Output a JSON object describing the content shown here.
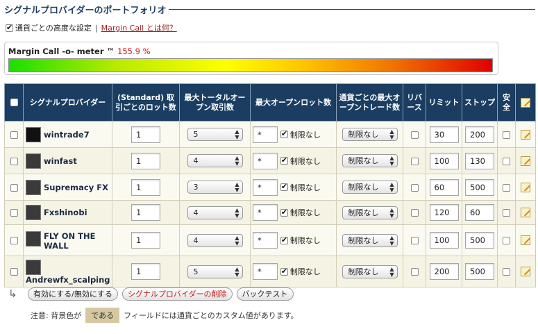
{
  "header": {
    "title": "シグナルプロバイダーのポートフォリオ"
  },
  "advanced": {
    "checkbox_label": "通貨ごとの高度な設定",
    "separator": "|",
    "link_text": "Margin Call とは何？",
    "checked": true
  },
  "meter": {
    "label": "Margin Call -o- meter ™",
    "value": "155.9 %",
    "value_color": "#e01010"
  },
  "table": {
    "columns": [
      "シグナルプロバイダー",
      "(Standard) 取引ごとのロット数",
      "最大トータルオープン取引数",
      "最大オープンロット数",
      "通貨ごとの最大オープントレード数",
      "リバース",
      "リミット",
      "ストップ",
      "安全"
    ],
    "rows": [
      {
        "provider": "wintrade7",
        "lots": "1",
        "max_trades": "5",
        "max_lots": "*",
        "no_limit": "制限なし",
        "per_currency": "制限なし",
        "limit": "30",
        "stop": "200"
      },
      {
        "provider": "winfast",
        "lots": "1",
        "max_trades": "4",
        "max_lots": "*",
        "no_limit": "制限なし",
        "per_currency": "制限なし",
        "limit": "100",
        "stop": "130"
      },
      {
        "provider": "Supremacy FX",
        "lots": "1",
        "max_trades": "3",
        "max_lots": "*",
        "no_limit": "制限なし",
        "per_currency": "制限なし",
        "limit": "60",
        "stop": "500"
      },
      {
        "provider": "Fxshinobi",
        "lots": "1",
        "max_trades": "4",
        "max_lots": "*",
        "no_limit": "制限なし",
        "per_currency": "制限なし",
        "limit": "120",
        "stop": "60"
      },
      {
        "provider": "FLY ON THE WALL",
        "lots": "1",
        "max_trades": "4",
        "max_lots": "*",
        "no_limit": "制限なし",
        "per_currency": "制限なし",
        "limit": "100",
        "stop": "500"
      },
      {
        "provider": "Andrewfx_scalping",
        "lots": "1",
        "max_trades": "5",
        "max_lots": "*",
        "no_limit": "制限なし",
        "per_currency": "制限なし",
        "limit": "200",
        "stop": "500"
      }
    ]
  },
  "actions": {
    "toggle": "有効にする/無効にする",
    "delete": "シグナルプロバイダーの削除",
    "backtest": "バックテスト"
  },
  "note": {
    "prefix": "注意: 背景色が",
    "swatch": "である",
    "suffix": "フィールドには通貨ごとのカスタム値があります。"
  }
}
